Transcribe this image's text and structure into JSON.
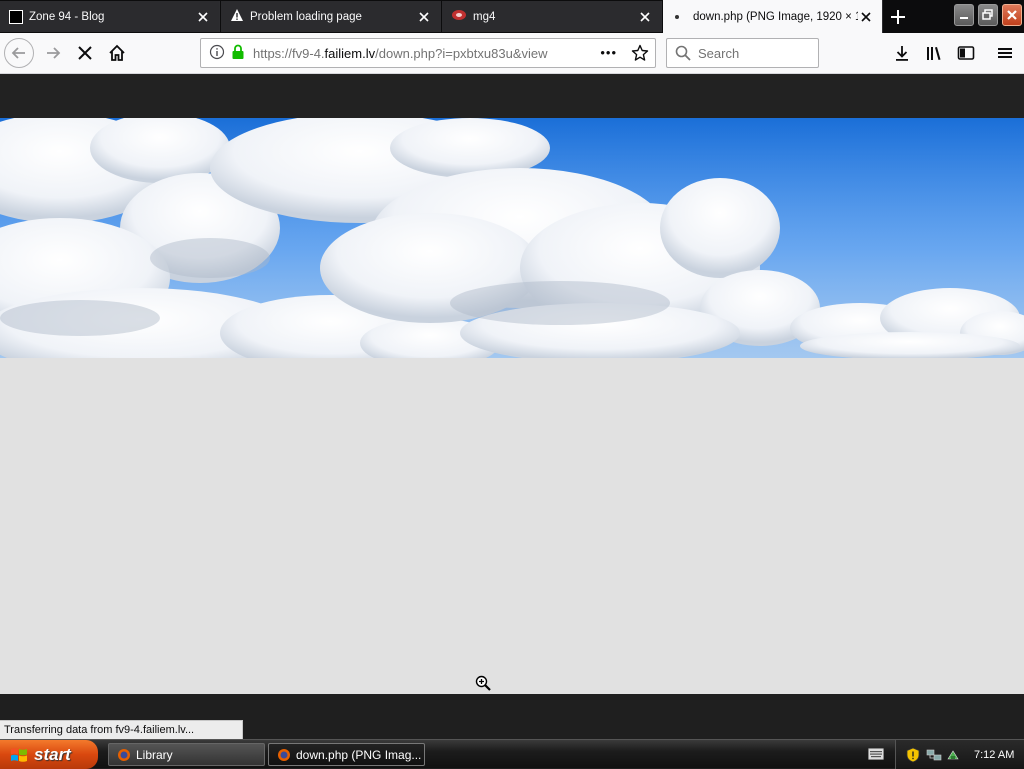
{
  "tabs": [
    {
      "title": "Zone 94 - Blog",
      "icon": "blog-favicon"
    },
    {
      "title": "Problem loading page",
      "icon": "warning-icon"
    },
    {
      "title": "mg4",
      "icon": "mg4-favicon"
    },
    {
      "title": "down.php (PNG Image, 1920 × 1",
      "icon": "loading-dot",
      "active": true
    }
  ],
  "navbar": {
    "url_prefix": "https://fv9-4.",
    "url_domain": "failiem.lv",
    "url_path": "/down.php?i=pxbtxu83u&view",
    "page_actions": "•••",
    "search_placeholder": "Search"
  },
  "status": {
    "text": "Transferring data from fv9-4.failiem.lv..."
  },
  "taskbar": {
    "start_label": "start",
    "items": [
      {
        "label": "Library",
        "active": false
      },
      {
        "label": "down.php (PNG Imag...",
        "active": true
      }
    ],
    "clock": "7:12 AM"
  },
  "colors": {
    "sky_blue": "#2f86ec",
    "page_gray": "#e1e1e1",
    "start_orange": "#d9480f"
  }
}
